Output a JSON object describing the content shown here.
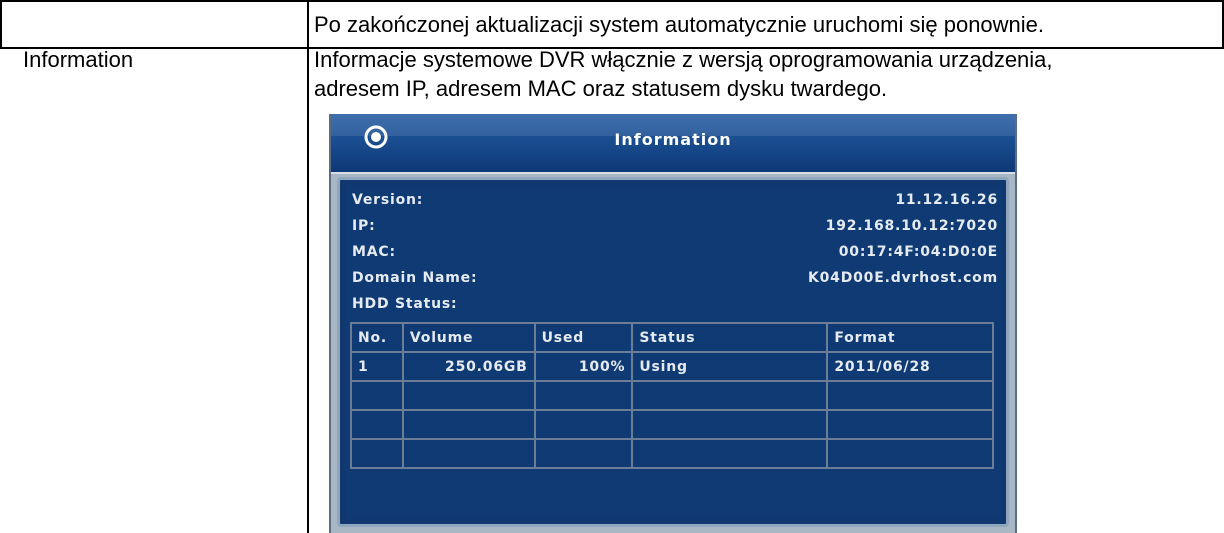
{
  "document": {
    "row_top_text": "Po zakończonej aktualizacji system automatycznie uruchomi się ponownie.",
    "row_label": "Information",
    "row_desc_line1": "Informacje systemowe DVR włącznie z wersją oprogramowania urządzenia,",
    "row_desc_line2": "adresem IP, adresem MAC oraz statusem dysku twardego."
  },
  "dvr": {
    "title": "Information",
    "version_label": "Version:",
    "version_value": "11.12.16.26",
    "ip_label": "IP:",
    "ip_value": "192.168.10.12:7020",
    "mac_label": "MAC:",
    "mac_value": "00:17:4F:04:D0:0E",
    "domain_label": "Domain Name:",
    "domain_value": "K04D00E.dvrhost.com",
    "hdd_label": "HDD Status:",
    "hdd_table": {
      "headers": [
        "No.",
        "Volume",
        "Used",
        "Status",
        "Format"
      ],
      "rows": [
        [
          "1",
          "250.06GB",
          "100%",
          "Using",
          "2011/06/28"
        ],
        [
          "",
          "",
          "",
          "",
          ""
        ],
        [
          "",
          "",
          "",
          "",
          ""
        ],
        [
          "",
          "",
          "",
          "",
          ""
        ]
      ]
    },
    "colors": {
      "titlebar": "#1b4f93",
      "panel": "#10386f",
      "text": "#e6ebf1",
      "grid": "#6b7e95"
    }
  }
}
